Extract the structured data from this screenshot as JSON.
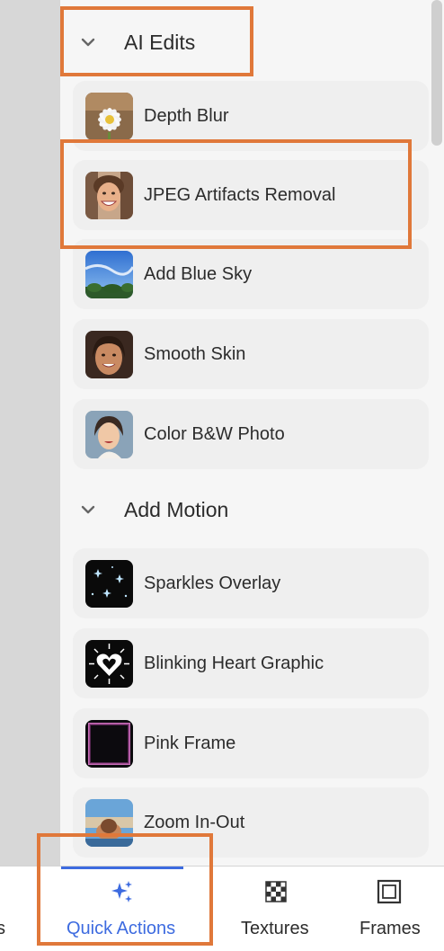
{
  "sections": [
    {
      "title": "AI Edits",
      "items": [
        {
          "label": "Depth Blur",
          "icon": "daisy-thumbnail"
        },
        {
          "label": "JPEG Artifacts Removal",
          "icon": "smiling-woman-thumbnail"
        },
        {
          "label": "Add Blue Sky",
          "icon": "blue-sky-thumbnail"
        },
        {
          "label": "Smooth Skin",
          "icon": "portrait-thumbnail"
        },
        {
          "label": "Color B&W Photo",
          "icon": "vintage-portrait-thumbnail"
        }
      ]
    },
    {
      "title": "Add Motion",
      "items": [
        {
          "label": "Sparkles Overlay",
          "icon": "sparkles-thumbnail"
        },
        {
          "label": "Blinking Heart Graphic",
          "icon": "heart-thumbnail"
        },
        {
          "label": "Pink Frame",
          "icon": "pink-frame-thumbnail"
        },
        {
          "label": "Zoom In-Out",
          "icon": "zoom-photo-thumbnail"
        }
      ]
    }
  ],
  "bottom_tabs": [
    {
      "label": "s",
      "icon": "none"
    },
    {
      "label": "Quick Actions",
      "icon": "sparkle-icon",
      "active": true
    },
    {
      "label": "Textures",
      "icon": "checkerboard-icon"
    },
    {
      "label": "Frames",
      "icon": "frame-icon"
    }
  ],
  "colors": {
    "accent": "#3d6be0",
    "highlight": "#e0783a",
    "panel_bg": "#f6f6f6",
    "item_bg": "#efefef"
  }
}
